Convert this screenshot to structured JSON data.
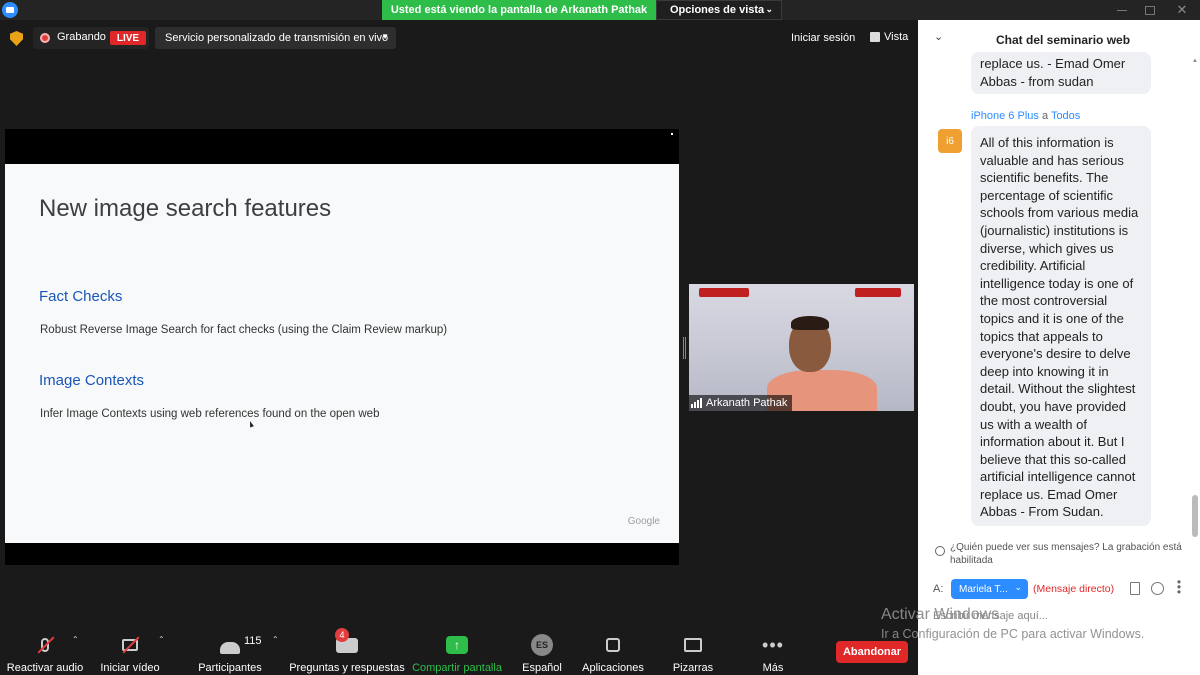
{
  "title_bar": {
    "share_banner": "Usted está viendo la pantalla de Arkanath Pathak",
    "view_options": "Opciones de vista"
  },
  "top_bar": {
    "recording_label": "Grabando",
    "live_badge": "LIVE",
    "stream_select": "Servicio personalizado de transmisión en vivo",
    "login": "Iniciar sesión",
    "view": "Vista"
  },
  "slide": {
    "title": "New image search features",
    "section1_heading": "Fact Checks",
    "section1_text": "Robust Reverse Image Search for fact checks (using the Claim Review markup)",
    "section2_heading": "Image Contexts",
    "section2_text": "Infer Image Contexts using web references found on the open web",
    "footer": "Google"
  },
  "speaker": {
    "name": "Arkanath Pathak"
  },
  "bottom_bar": {
    "mic": "Reactivar audio",
    "video": "Iniciar vídeo",
    "participants": "Participantes",
    "participants_count": "115",
    "qa": "Preguntas y respuestas",
    "qa_badge": "4",
    "share": "Compartir pantalla",
    "language": "Español",
    "language_code": "ES",
    "apps": "Aplicaciones",
    "whiteboards": "Pizarras",
    "more": "Más",
    "leave": "Abandonar"
  },
  "chat": {
    "title": "Chat del seminario web",
    "msg1_text": "replace us.      - Emad Omer Abbas - from sudan",
    "msg2_sender": "iPhone 6 Plus",
    "msg2_to_word": "a",
    "msg2_recipient": "Todos",
    "msg2_avatar": "i6",
    "msg2_text": "All of this information is valuable and has serious scientific benefits. The percentage of scientific schools from various media (journalistic) institutions is diverse, which gives us credibility. Artificial intelligence today is one of the most controversial topics and it is one of the topics that appeals to everyone's desire to delve deep into knowing it in detail. Without the slightest doubt, you have provided us with a wealth of information about it. But I believe that this so-called artificial intelligence cannot replace us.       Emad Omer Abbas - From Sudan.",
    "privacy_note": "¿Quién puede ver sus mensajes? La grabación está habilitada",
    "to_label": "A:",
    "recipient": "Mariela T...",
    "dm_label": "(Mensaje directo)",
    "input_placeholder": "Escribir mensaje aquí..."
  },
  "watermark": {
    "title": "Activar Windows",
    "subtitle": "Ir a Configuración de PC para activar Windows."
  },
  "colors": {
    "zoom_blue": "#2d8cff",
    "share_green": "#2fbd4a",
    "live_red": "#e02828",
    "slide_heading_blue": "#1a56b8"
  }
}
